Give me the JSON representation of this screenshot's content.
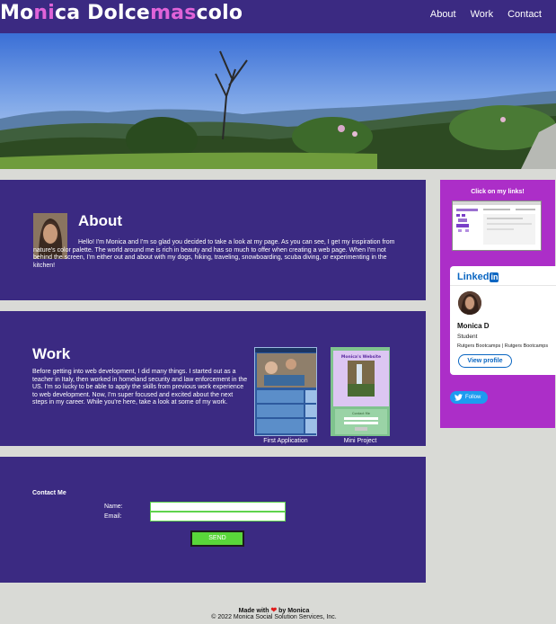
{
  "header": {
    "brand_parts": [
      "Mo",
      "ni",
      "ca Dolce",
      "mas",
      "colo"
    ],
    "nav": [
      "About",
      "Work",
      "Contact"
    ]
  },
  "about": {
    "title": "About",
    "text": "Hello! I'm Monica and I'm so glad you decided to take a look at my page. As you can see, I get my inspiration from nature's color palette. The world around me is rich in beauty and has so much to offer when creating a web page. When I'm not behind the screen, I'm either out and about with my dogs, hiking, traveling, snowboarding, scuba diving, or experimenting in the kitchen!"
  },
  "work": {
    "title": "Work",
    "text": "Before getting into web development, I did many things. I started out as a teacher in Italy, then worked in homeland security and law enforcement in the US. I'm so lucky to be able to apply the skills from previous work experience to web development. Now, I'm super focused and excited about the next steps in my career. While you're here, take a look at some of my work.",
    "projects": [
      {
        "caption": "First Application"
      },
      {
        "caption": "Mini Project",
        "screenshot_title": "Monica's Website",
        "screenshot_label": "Contact Me"
      }
    ]
  },
  "contact": {
    "title": "Contact Me",
    "name_label": "Name:",
    "email_label": "Email:",
    "send_label": "SEND"
  },
  "sidebar": {
    "click_links": "Click on my links!",
    "linkedin": {
      "logo_text": "Linked",
      "logo_in": "in",
      "name": "Monica D",
      "title": "Student",
      "company": "Rutgers Bootcamps | Rutgers Bootcamps",
      "button": "View profile"
    },
    "twitter_button": "Follow"
  },
  "footer": {
    "made_with_prefix": "Made with",
    "made_with_suffix": "by Monica",
    "copyright": "© 2022 Monica Social Solution Services, Inc."
  },
  "colors": {
    "purple": "#3b2a82",
    "magenta": "#ac2ec8",
    "accent_pink": "#e063d8",
    "send_green": "#59d63a",
    "page_bg": "#d9dad6"
  }
}
